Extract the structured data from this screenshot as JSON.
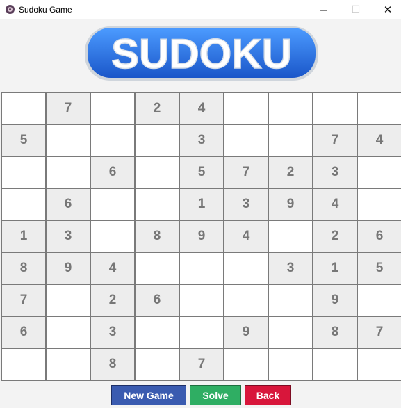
{
  "window": {
    "title": "Sudoku Game",
    "minimize_glyph": "—",
    "maximize_glyph": "☐",
    "close_glyph": "✕"
  },
  "logo": {
    "text": "SUDOKU"
  },
  "board": {
    "rows": [
      [
        "",
        "7",
        "",
        "2",
        "4",
        "",
        "",
        "",
        ""
      ],
      [
        "5",
        "",
        "",
        "",
        "3",
        "",
        "",
        "7",
        "4"
      ],
      [
        "",
        "",
        "6",
        "",
        "5",
        "7",
        "2",
        "3",
        ""
      ],
      [
        "",
        "6",
        "",
        "",
        "1",
        "3",
        "9",
        "4",
        ""
      ],
      [
        "1",
        "3",
        "",
        "8",
        "9",
        "4",
        "",
        "2",
        "6"
      ],
      [
        "8",
        "9",
        "4",
        "",
        "",
        "",
        "3",
        "1",
        "5"
      ],
      [
        "7",
        "",
        "2",
        "6",
        "",
        "",
        "",
        "9",
        ""
      ],
      [
        "6",
        "",
        "3",
        "",
        "",
        "9",
        "",
        "8",
        "7"
      ],
      [
        "",
        "",
        "8",
        "",
        "7",
        "",
        "",
        "",
        ""
      ]
    ]
  },
  "buttons": {
    "new_game": "New Game",
    "solve": "Solve",
    "back": "Back"
  },
  "colors": {
    "given_cell": "#ededed",
    "empty_cell": "#ffffff",
    "digit": "#777777",
    "new_game": "#3a5bb0",
    "solve": "#2fae63",
    "back": "#d8163b",
    "logo_blue": "#1f6fe0"
  }
}
